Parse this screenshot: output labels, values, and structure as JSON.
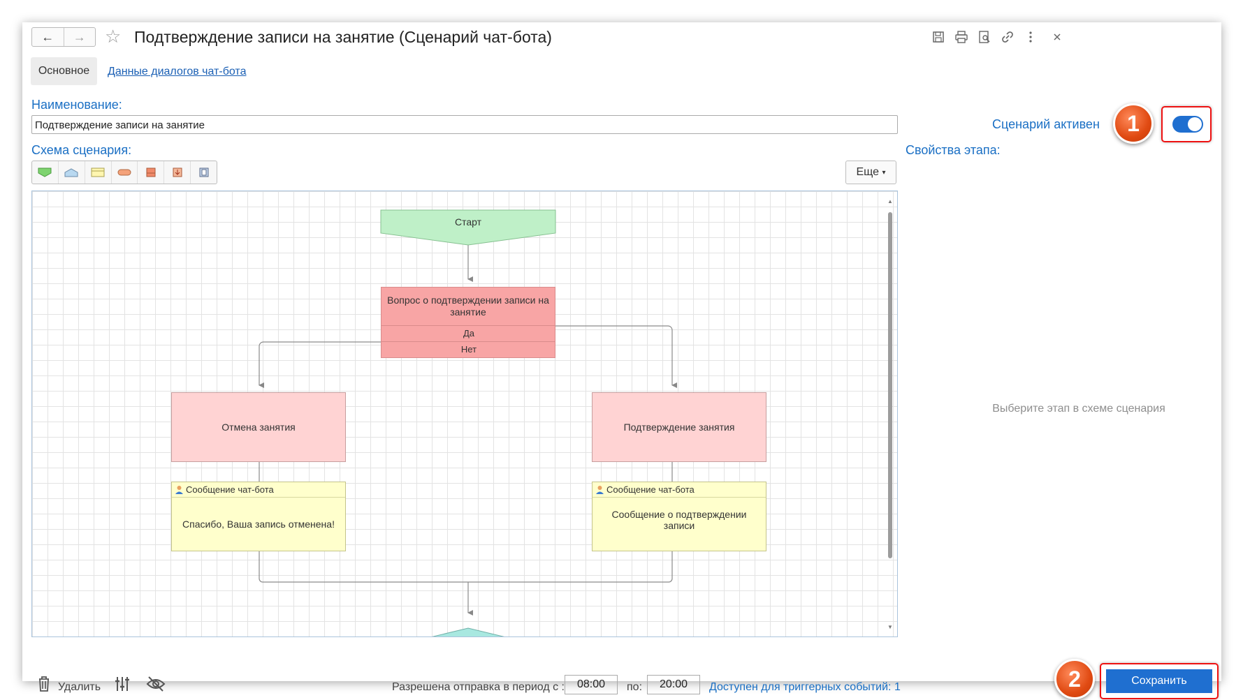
{
  "header": {
    "title": "Подтверждение записи на занятие (Сценарий чат-бота)",
    "back_icon": "arrow-left-icon",
    "forward_icon": "arrow-right-icon",
    "favorite_icon": "star-icon",
    "actions": [
      "save-icon",
      "print-icon",
      "preview-icon",
      "link-icon",
      "more-vertical-icon",
      "close-icon"
    ]
  },
  "tabs": [
    {
      "label": "Основное",
      "active": true
    },
    {
      "label": "Данные диалогов чат-бота",
      "active": false
    }
  ],
  "form": {
    "name_label": "Наименование:",
    "name_value": "Подтверждение записи на занятие",
    "active_label": "Сценарий активен",
    "active": true,
    "schema_label": "Схема сценария:",
    "more_button": "Еще",
    "properties_label": "Свойства этапа:",
    "properties_placeholder": "Выберите этап в схеме сценария"
  },
  "schema": {
    "start": "Старт",
    "question": {
      "text": "Вопрос о подтверждении записи на занятие",
      "options": [
        "Да",
        "Нет"
      ]
    },
    "cancel_step": "Отмена занятия",
    "confirm_step": "Подтверждение занятия",
    "messages": [
      {
        "header": "Сообщение чат-бота",
        "body": "Спасибо, Ваша запись отменена!"
      },
      {
        "header": "Сообщение чат-бота",
        "body": "Сообщение о подтверждении записи"
      }
    ]
  },
  "footer": {
    "delete_label": "Удалить",
    "period_label": "Разрешена отправка в период с :",
    "time_from": "08:00",
    "to_label": "по:",
    "time_to": "20:00",
    "triggers_link": "Доступен для триггерных событий: 1",
    "save_button": "Сохранить"
  },
  "annotations": {
    "badge1": "1",
    "badge2": "2"
  },
  "colors": {
    "accent": "#1f6fd0",
    "link": "#1a5fb4",
    "start_node": "#bff0c8",
    "question_node": "#f8a5a5",
    "action_node": "#ffd3d3",
    "message_node": "#ffffcc",
    "annotation": "#e04a12"
  }
}
